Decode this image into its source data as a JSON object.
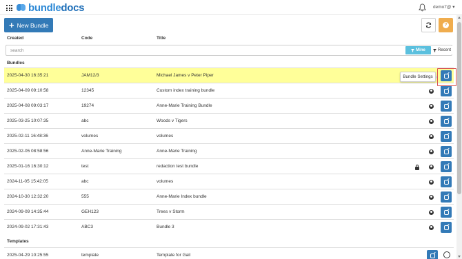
{
  "app": {
    "logo_text_a": "bundle",
    "logo_text_b": "docs",
    "user_menu": "demo7@ ▾"
  },
  "toolbar": {
    "new_bundle_label": "New Bundle",
    "help_glyph": "?"
  },
  "columns": {
    "created": "Created",
    "code": "Code",
    "title": "Title"
  },
  "search": {
    "placeholder": "search",
    "mine_label": "Mine",
    "recent_label": "Recent"
  },
  "sections": {
    "bundles": "Bundles",
    "templates": "Templates"
  },
  "tooltip": "Bundle Settings",
  "bundles": [
    {
      "created": "2025-04-30 16:35:21",
      "code": "JAM12/3",
      "title": "Michael James v Peter Piper"
    },
    {
      "created": "2025-04-09 09:10:58",
      "code": "12345",
      "title": "Custom index training bundle"
    },
    {
      "created": "2025-04-08 09:03:17",
      "code": "19274",
      "title": "Anne-Marie Training Bundle"
    },
    {
      "created": "2025-03-25 10:07:35",
      "code": "abc",
      "title": "Woods v Tigers"
    },
    {
      "created": "2025-02-11 16:48:36",
      "code": "volumes",
      "title": "volumes"
    },
    {
      "created": "2025-02-05 08:58:56",
      "code": "Anne-Marie Training",
      "title": "Anne-Marie Training"
    },
    {
      "created": "2025-01-16 16:30:12",
      "code": "test",
      "title": "redaction test bundle"
    },
    {
      "created": "2024-11-05 15:42:05",
      "code": "abc",
      "title": "volumes"
    },
    {
      "created": "2024-10-30 12:32:20",
      "code": "555",
      "title": "Anne-Marie Index bundle"
    },
    {
      "created": "2024-09-09 14:35:44",
      "code": "GEH123",
      "title": "Trees v Storm"
    },
    {
      "created": "2024-09-02 17:31:43",
      "code": "ABC3",
      "title": "Bundle 3"
    }
  ],
  "templates": [
    {
      "created": "2025-04-29 10:25:55",
      "code": "template",
      "title": "Template for Gail"
    }
  ],
  "colors": {
    "primary": "#337ab7",
    "info": "#5bc0de",
    "warning": "#f0ad4e",
    "highlight_row": "#ffff99",
    "focus_border": "#d9534f"
  }
}
